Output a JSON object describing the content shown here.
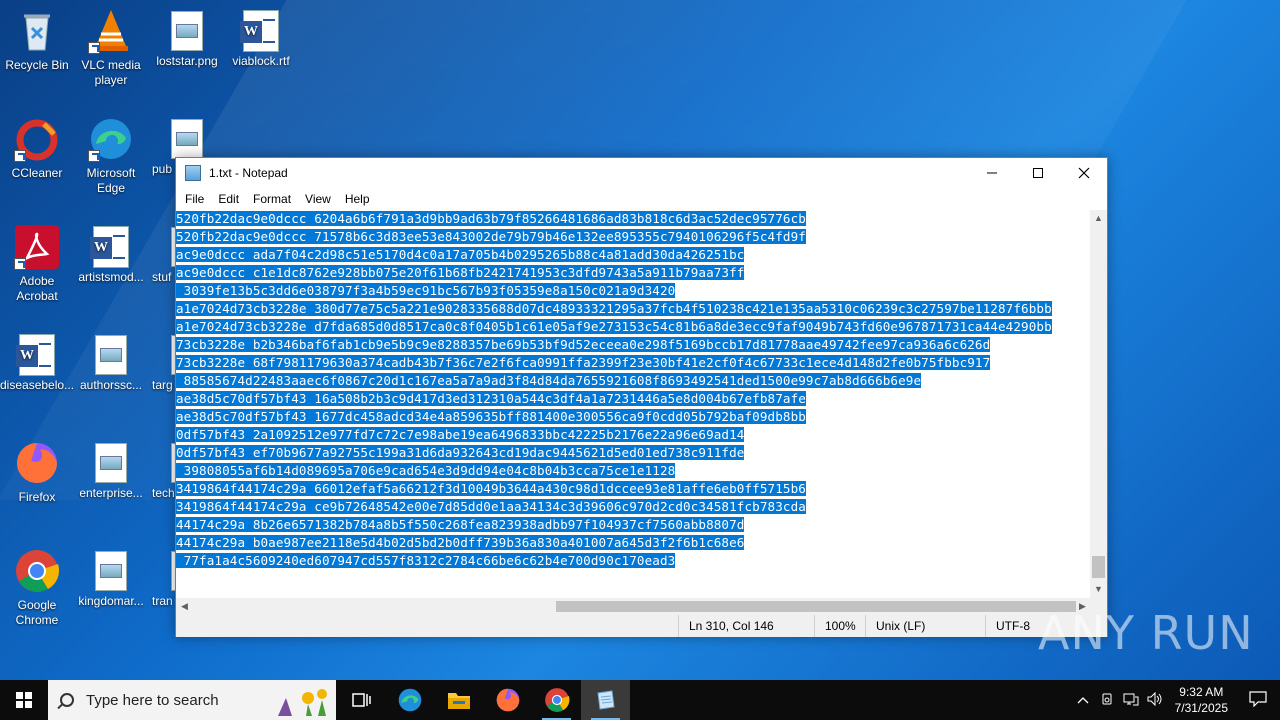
{
  "desktop": {
    "icons": [
      {
        "label": "Recycle Bin"
      },
      {
        "label": "VLC media player"
      },
      {
        "label": "loststar.png"
      },
      {
        "label": "viablock.rtf"
      },
      {
        "label": "CCleaner"
      },
      {
        "label": "Microsoft Edge"
      },
      {
        "label": "pub"
      },
      {
        "label": "Adobe Acrobat"
      },
      {
        "label": "artistsmod..."
      },
      {
        "label": "stuf"
      },
      {
        "label": "diseasebelo..."
      },
      {
        "label": "authorssc..."
      },
      {
        "label": "targ"
      },
      {
        "label": "Firefox"
      },
      {
        "label": "enterprise..."
      },
      {
        "label": "tech"
      },
      {
        "label": "Google Chrome"
      },
      {
        "label": "kingdomar..."
      },
      {
        "label": "tran"
      }
    ]
  },
  "notepad": {
    "title": "1.txt - Notepad",
    "menu": [
      "File",
      "Edit",
      "Format",
      "View",
      "Help"
    ],
    "lines": [
      "520fb22dac9e0dccc 6204a6b6f791a3d9bb9ad63b79f85266481686ad83b818c6d3ac52dec95776cb",
      "520fb22dac9e0dccc 71578b6c3d83ee53e843002de79b79b46e132ee895355c7940106296f5c4fd9f",
      "ac9e0dccc ada7f04c2d98c51e5170d4c0a17a705b4b0295265b88c4a81add30da426251bc",
      "ac9e0dccc c1e1dc8762e928bb075e20f61b68fb2421741953c3dfd9743a5a911b79aa73ff",
      " 3039fe13b5c3dd6e038797f3a4b59ec91bc567b93f05359e8a150c021a9d3420",
      "a1e7024d73cb3228e 380d77e75c5a221e9028335688d07dc48933321295a37fcb4f510238c421e135aa5310c06239c3c27597be11287f6bbb",
      "a1e7024d73cb3228e d7fda685d0d8517ca0c8f0405b1c61e05af9e273153c54c81b6a8de3ecc9faf9049b743fd60e967871731ca44e4290bb",
      "73cb3228e b2b346baf6fab1cb9e5b9c9e8288357be69b53bf9d52eceea0e298f5169bccb17d81778aae49742fee97ca936a6c626d",
      "73cb3228e 68f7981179630a374cadb43b7f36c7e2f6fca0991ffa2399f23e30bf41e2cf0f4c67733c1ece4d148d2fe0b75fbbc917",
      " 88585674d22483aaec6f0867c20d1c167ea5a7a9ad3f84d84da7655921608f8693492541ded1500e99c7ab8d666b6e9e",
      "ae38d5c70df57bf43 16a508b2b3c9d417d3ed312310a544c3df4a1a7231446a5e8d004b67efb87afe",
      "ae38d5c70df57bf43 1677dc458adcd34e4a859635bff881400e300556ca9f0cdd05b792baf09db8bb",
      "0df57bf43 2a1092512e977fd7c72c7e98abe19ea6496833bbc42225b2176e22a96e69ad14",
      "0df57bf43 ef70b9677a92755c199a31d6da932643cd19dac9445621d5ed01ed738c911fde",
      " 39808055af6b14d089695a706e9cad654e3d9dd94e04c8b04b3cca75ce1e1128",
      "3419864f44174c29a 66012efaf5a66212f3d10049b3644a430c98d1dccee93e81affe6eb0ff5715b6",
      "3419864f44174c29a ce9b72648542e00e7d85dd0e1aa34134c3d39606c970d2cd0c34581fcb783cda",
      "44174c29a 8b26e6571382b784a8b5f550c268fea823938adbb97f104937cf7560abb8807d",
      "44174c29a b0ae987ee2118e5d4b02d5bd2b0dff739b36a830a401007a645d3f2f6b1c68e6",
      " 77fa1a4c5609240ed607947cd557f8312c2784c66be6c62b4e700d90c170ead3"
    ],
    "status": {
      "position": "Ln 310, Col 146",
      "zoom": "100%",
      "line_ending": "Unix (LF)",
      "encoding": "UTF-8"
    }
  },
  "watermark": "ANY RUN",
  "taskbar": {
    "search_placeholder": "Type here to search",
    "time": "9:32 AM",
    "date": "7/31/2025"
  }
}
